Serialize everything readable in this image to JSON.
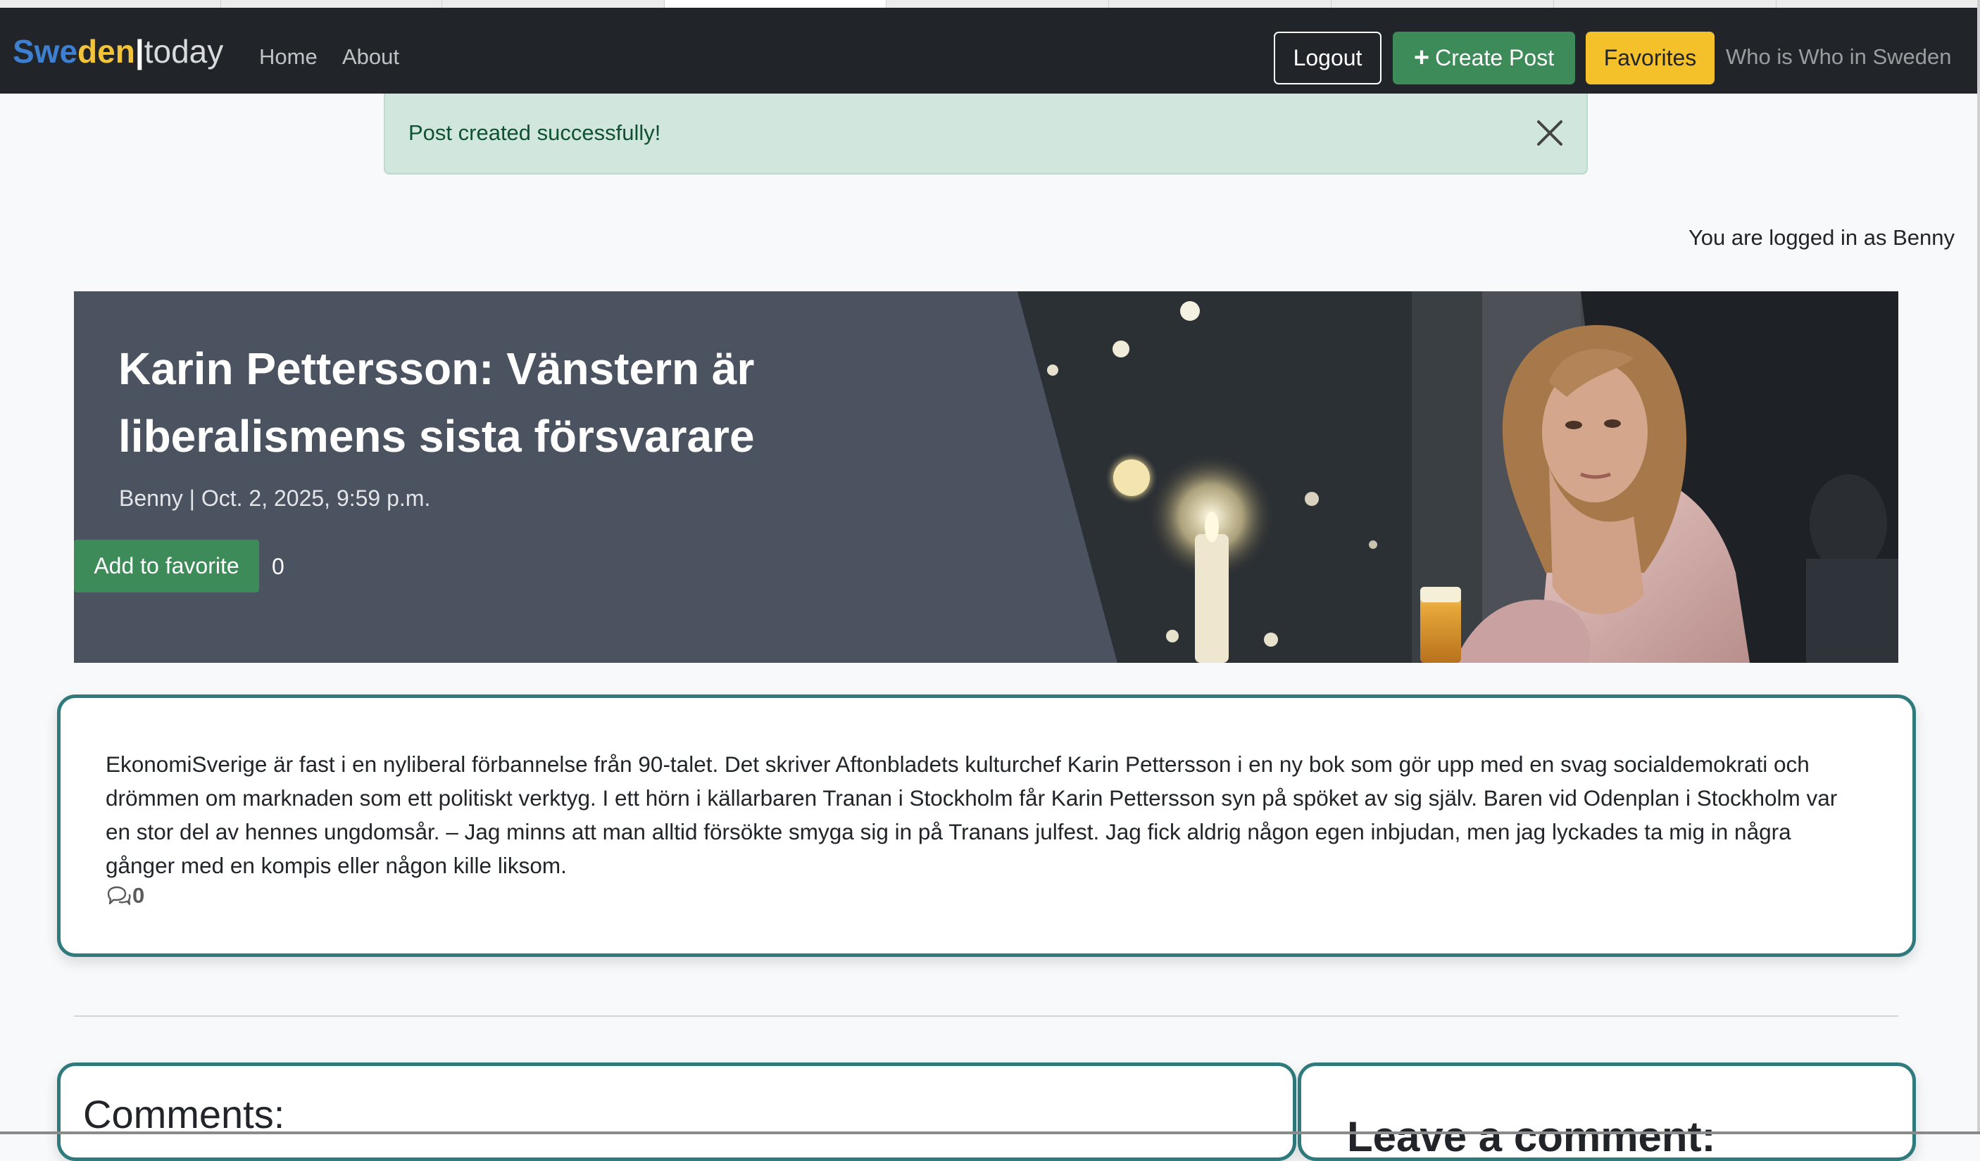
{
  "brand": {
    "part1": "Swe",
    "part2": "den",
    "separator": "|",
    "part3": "today"
  },
  "nav": {
    "home": "Home",
    "about": "About",
    "logout": "Logout",
    "create_post": "Create Post",
    "favorites": "Favorites",
    "who_is_who": "Who is Who in Sweden"
  },
  "alert": {
    "message": "Post created successfully!"
  },
  "user_status": "You are logged in as Benny",
  "post": {
    "title": "Karin Pettersson: Vänstern är liberalismens sista försvarare",
    "meta": "Benny | Oct. 2, 2025, 9:59 p.m.",
    "add_favorite_label": "Add to favorite",
    "favorite_count": "0",
    "body": "EkonomiSverige är fast i en nyliberal förbannelse från 90-talet. Det skriver Aftonbladets kulturchef Karin Pettersson i en ny bok som gör upp med en svag socialdemokrati och drömmen om marknaden som ett politiskt verktyg. I ett hörn i källarbaren Tranan i Stockholm får Karin Pettersson syn på spöket av sig själv. Baren vid Odenplan i Stockholm var en stor del av hennes ungdomsår. – Jag minns att man alltid försökte smyga sig in på Tranans julfest. Jag fick aldrig någon egen inbjudan, men jag lyckades ta mig in några gånger med en kompis eller någon kille liksom.",
    "comment_count": "0"
  },
  "comments_section": {
    "title": "Comments:"
  },
  "leave_comment": {
    "title": "Leave a comment:"
  },
  "colors": {
    "navbar_bg": "#212529",
    "success_green": "#3d8b58",
    "warning_yellow": "#f5c12a",
    "card_border": "#2f7a7d",
    "alert_bg": "#d1e7dd"
  },
  "icons": {
    "create_post": "plus-icon",
    "alert_close": "close-icon",
    "comments": "chat-bubbles-icon"
  }
}
